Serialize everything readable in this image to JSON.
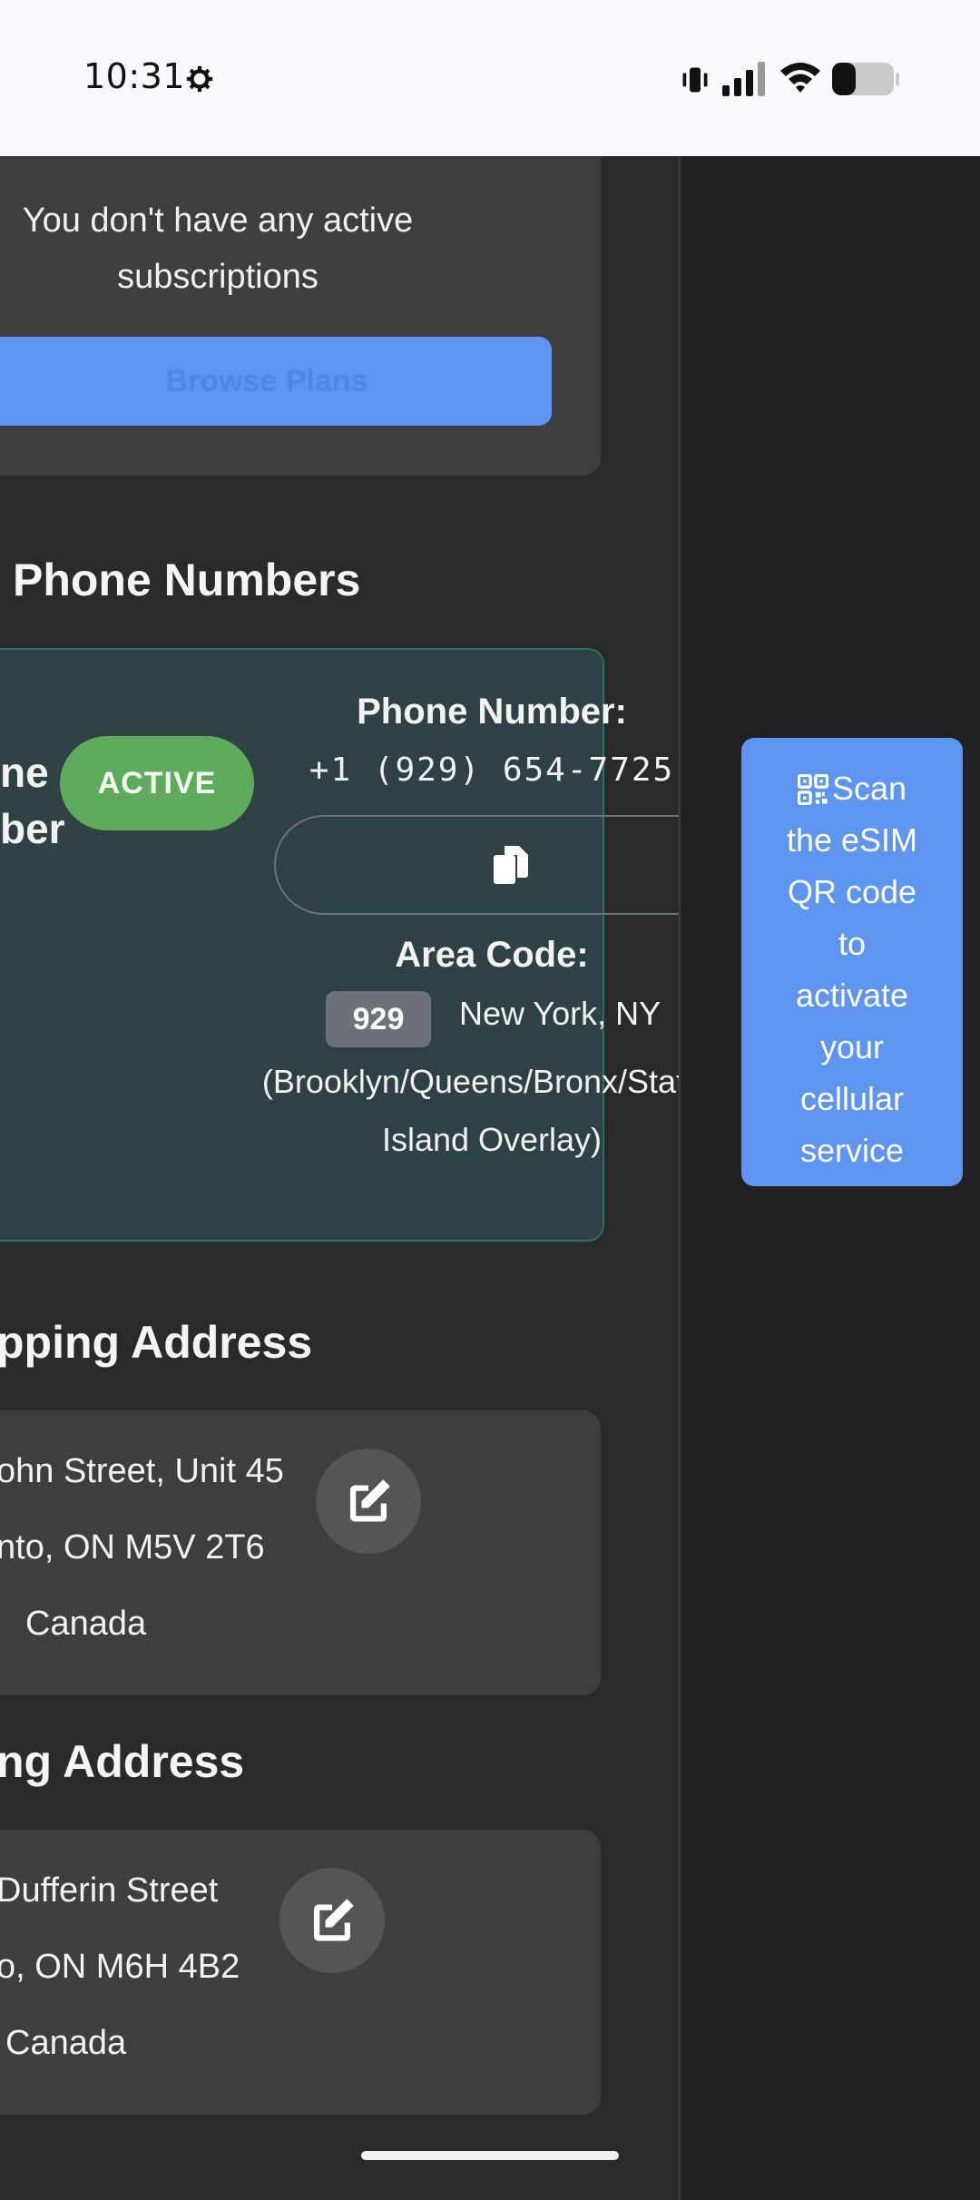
{
  "status_bar": {
    "time": "10:31"
  },
  "subscriptions": {
    "empty_text_line1": "You don't have any active",
    "empty_text_line2": "subscriptions",
    "browse_button": "Browse Plans"
  },
  "phone_numbers": {
    "section_title": "Phone Numbers",
    "card_title_line1": "ne",
    "card_title_line2": "ber",
    "status_badge": "ACTIVE",
    "phone_label": "Phone Number:",
    "phone_value": "+1 (929) 654-7725",
    "area_label": "Area Code:",
    "area_code": "929",
    "area_city": "New York, NY",
    "area_region_line1": "(Brooklyn/Queens/Bronx/Staten",
    "area_region_line2": "Island Overlay)"
  },
  "esim_prompt": {
    "line1": "Scan",
    "line2": "the eSIM",
    "line3": "QR code",
    "line4": "to",
    "line5": "activate",
    "line6": "your",
    "line7": "cellular",
    "line8": "service"
  },
  "shipping_address": {
    "section_title": "pping Address",
    "line1": "ohn Street, Unit 45",
    "line2": "nto, ON M5V 2T6",
    "line3": "Canada"
  },
  "billing_address": {
    "section_title": "ng Address",
    "line1": "Dufferin Street",
    "line2": "o, ON M6H 4B2",
    "line3": "Canada"
  },
  "icons": [
    "settings-gear-icon",
    "vibrate-icon",
    "signal-icon",
    "wifi-icon",
    "battery-icon",
    "copy-icon",
    "qr-code-icon",
    "edit-icon"
  ],
  "colors": {
    "accent_blue": "#5e95f0",
    "active_green": "#5eac5b",
    "phone_card_bg": "#2e4144"
  }
}
